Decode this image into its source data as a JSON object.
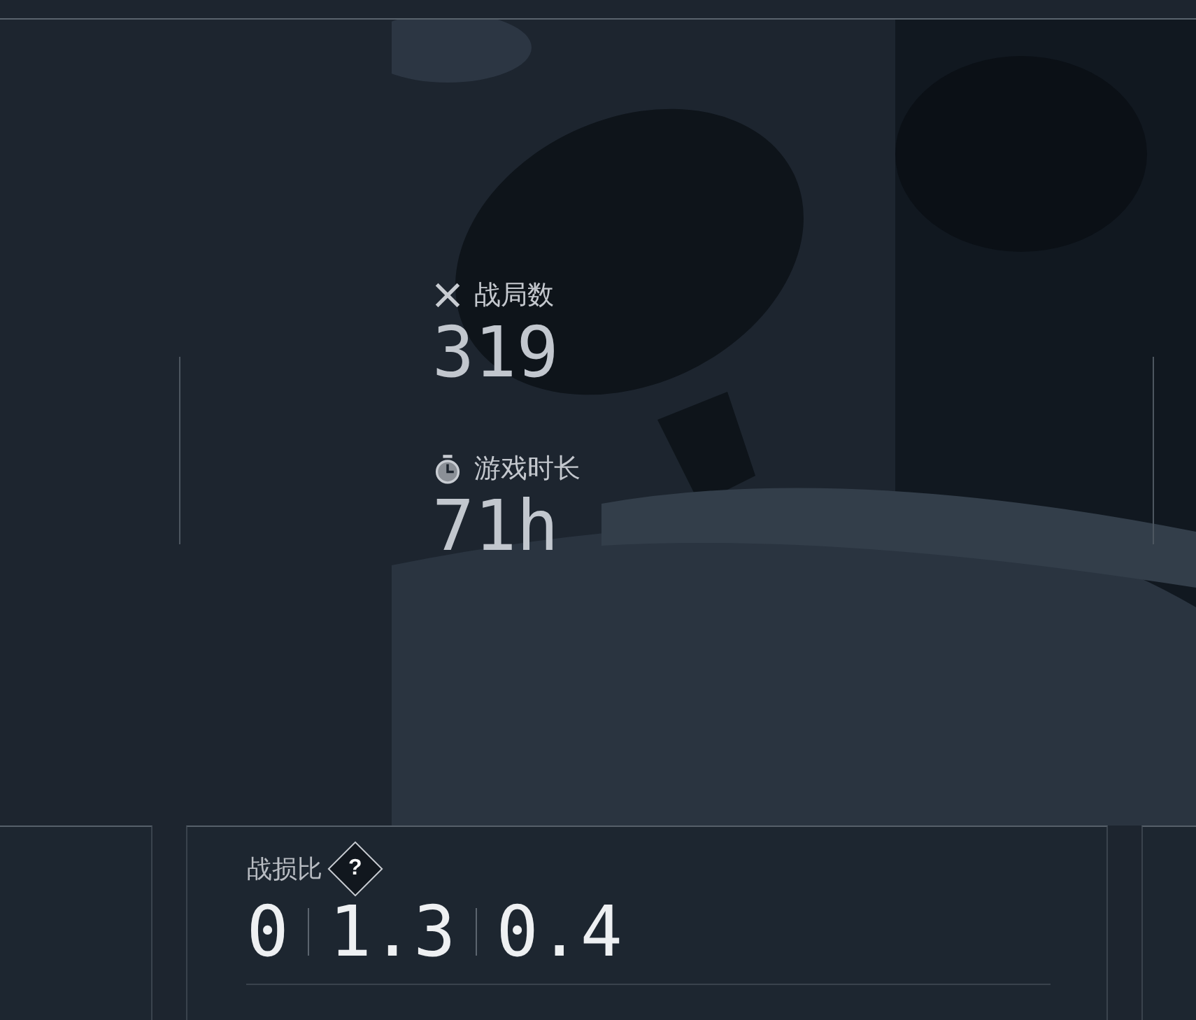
{
  "stats": [
    {
      "kind": "battles",
      "label": "战局数",
      "value": "319"
    },
    {
      "kind": "playtime",
      "label": "游戏时长",
      "value": "71h"
    }
  ],
  "ratio_card": {
    "label": "战损比",
    "help": "?",
    "values": [
      "0",
      "1.3",
      "0.4"
    ]
  }
}
